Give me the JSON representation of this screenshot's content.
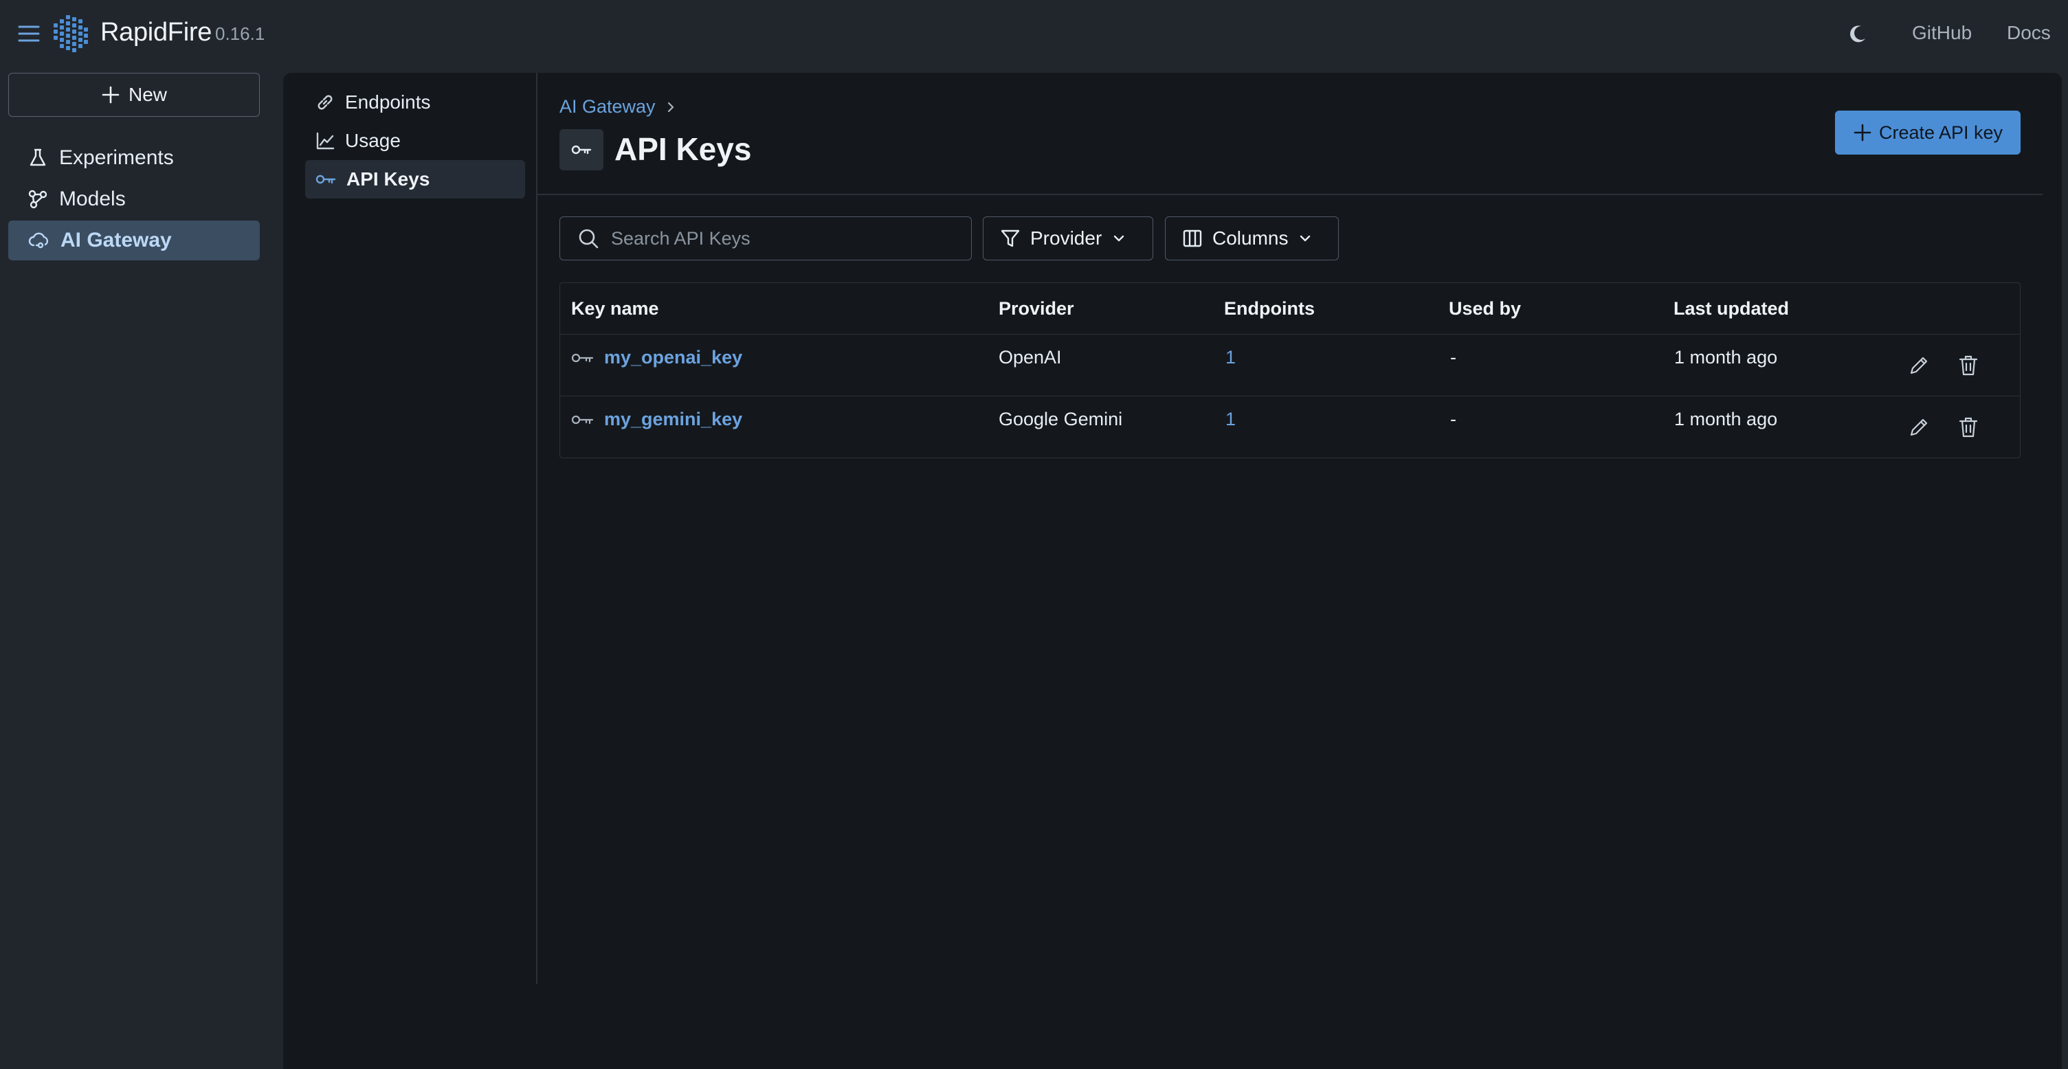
{
  "app": {
    "name": "RapidFire",
    "version": "0.16.1"
  },
  "topbar": {
    "links": [
      {
        "label": "GitHub"
      },
      {
        "label": "Docs"
      }
    ]
  },
  "sidebar": {
    "new_label": "New",
    "items": [
      {
        "label": "Experiments",
        "icon": "flask-icon"
      },
      {
        "label": "Models",
        "icon": "models-icon"
      },
      {
        "label": "AI Gateway",
        "icon": "cloud-gateway-icon",
        "active": true
      }
    ]
  },
  "subnav": {
    "items": [
      {
        "label": "Endpoints",
        "icon": "link-icon"
      },
      {
        "label": "Usage",
        "icon": "chart-line-icon"
      },
      {
        "label": "API Keys",
        "icon": "key-icon",
        "active": true
      }
    ]
  },
  "breadcrumb": {
    "parent": "AI Gateway",
    "separator": "›"
  },
  "page": {
    "title": "API Keys",
    "create_label": "Create API key"
  },
  "toolbar": {
    "search_placeholder": "Search API Keys",
    "provider_label": "Provider",
    "columns_label": "Columns"
  },
  "table": {
    "headers": [
      "Key name",
      "Provider",
      "Endpoints",
      "Used by",
      "Last updated"
    ],
    "rows": [
      {
        "key_name": "my_openai_key",
        "provider": "OpenAI",
        "endpoints": "1",
        "used_by": "-",
        "last_updated": "1 month ago"
      },
      {
        "key_name": "my_gemini_key",
        "provider": "Google Gemini",
        "endpoints": "1",
        "used_by": "-",
        "last_updated": "1 month ago"
      }
    ]
  },
  "colors": {
    "accent": "#4c8ed6",
    "link": "#6ca3de",
    "background": "#21262d",
    "panel": "#14181d",
    "sidebar_active": "#3b4d61"
  }
}
